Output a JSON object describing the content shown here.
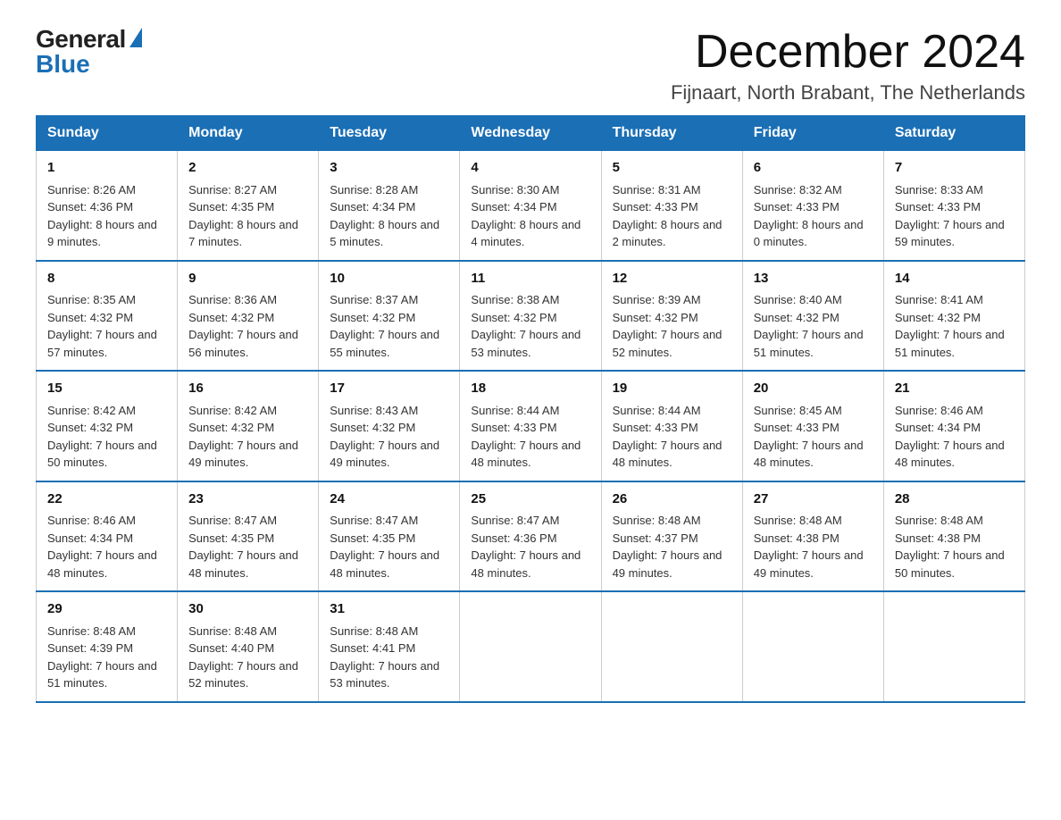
{
  "logo": {
    "general": "General",
    "blue": "Blue"
  },
  "header": {
    "month": "December 2024",
    "location": "Fijnaart, North Brabant, The Netherlands"
  },
  "weekdays": [
    "Sunday",
    "Monday",
    "Tuesday",
    "Wednesday",
    "Thursday",
    "Friday",
    "Saturday"
  ],
  "weeks": [
    [
      {
        "day": "1",
        "sunrise": "8:26 AM",
        "sunset": "4:36 PM",
        "daylight": "8 hours and 9 minutes."
      },
      {
        "day": "2",
        "sunrise": "8:27 AM",
        "sunset": "4:35 PM",
        "daylight": "8 hours and 7 minutes."
      },
      {
        "day": "3",
        "sunrise": "8:28 AM",
        "sunset": "4:34 PM",
        "daylight": "8 hours and 5 minutes."
      },
      {
        "day": "4",
        "sunrise": "8:30 AM",
        "sunset": "4:34 PM",
        "daylight": "8 hours and 4 minutes."
      },
      {
        "day": "5",
        "sunrise": "8:31 AM",
        "sunset": "4:33 PM",
        "daylight": "8 hours and 2 minutes."
      },
      {
        "day": "6",
        "sunrise": "8:32 AM",
        "sunset": "4:33 PM",
        "daylight": "8 hours and 0 minutes."
      },
      {
        "day": "7",
        "sunrise": "8:33 AM",
        "sunset": "4:33 PM",
        "daylight": "7 hours and 59 minutes."
      }
    ],
    [
      {
        "day": "8",
        "sunrise": "8:35 AM",
        "sunset": "4:32 PM",
        "daylight": "7 hours and 57 minutes."
      },
      {
        "day": "9",
        "sunrise": "8:36 AM",
        "sunset": "4:32 PM",
        "daylight": "7 hours and 56 minutes."
      },
      {
        "day": "10",
        "sunrise": "8:37 AM",
        "sunset": "4:32 PM",
        "daylight": "7 hours and 55 minutes."
      },
      {
        "day": "11",
        "sunrise": "8:38 AM",
        "sunset": "4:32 PM",
        "daylight": "7 hours and 53 minutes."
      },
      {
        "day": "12",
        "sunrise": "8:39 AM",
        "sunset": "4:32 PM",
        "daylight": "7 hours and 52 minutes."
      },
      {
        "day": "13",
        "sunrise": "8:40 AM",
        "sunset": "4:32 PM",
        "daylight": "7 hours and 51 minutes."
      },
      {
        "day": "14",
        "sunrise": "8:41 AM",
        "sunset": "4:32 PM",
        "daylight": "7 hours and 51 minutes."
      }
    ],
    [
      {
        "day": "15",
        "sunrise": "8:42 AM",
        "sunset": "4:32 PM",
        "daylight": "7 hours and 50 minutes."
      },
      {
        "day": "16",
        "sunrise": "8:42 AM",
        "sunset": "4:32 PM",
        "daylight": "7 hours and 49 minutes."
      },
      {
        "day": "17",
        "sunrise": "8:43 AM",
        "sunset": "4:32 PM",
        "daylight": "7 hours and 49 minutes."
      },
      {
        "day": "18",
        "sunrise": "8:44 AM",
        "sunset": "4:33 PM",
        "daylight": "7 hours and 48 minutes."
      },
      {
        "day": "19",
        "sunrise": "8:44 AM",
        "sunset": "4:33 PM",
        "daylight": "7 hours and 48 minutes."
      },
      {
        "day": "20",
        "sunrise": "8:45 AM",
        "sunset": "4:33 PM",
        "daylight": "7 hours and 48 minutes."
      },
      {
        "day": "21",
        "sunrise": "8:46 AM",
        "sunset": "4:34 PM",
        "daylight": "7 hours and 48 minutes."
      }
    ],
    [
      {
        "day": "22",
        "sunrise": "8:46 AM",
        "sunset": "4:34 PM",
        "daylight": "7 hours and 48 minutes."
      },
      {
        "day": "23",
        "sunrise": "8:47 AM",
        "sunset": "4:35 PM",
        "daylight": "7 hours and 48 minutes."
      },
      {
        "day": "24",
        "sunrise": "8:47 AM",
        "sunset": "4:35 PM",
        "daylight": "7 hours and 48 minutes."
      },
      {
        "day": "25",
        "sunrise": "8:47 AM",
        "sunset": "4:36 PM",
        "daylight": "7 hours and 48 minutes."
      },
      {
        "day": "26",
        "sunrise": "8:48 AM",
        "sunset": "4:37 PM",
        "daylight": "7 hours and 49 minutes."
      },
      {
        "day": "27",
        "sunrise": "8:48 AM",
        "sunset": "4:38 PM",
        "daylight": "7 hours and 49 minutes."
      },
      {
        "day": "28",
        "sunrise": "8:48 AM",
        "sunset": "4:38 PM",
        "daylight": "7 hours and 50 minutes."
      }
    ],
    [
      {
        "day": "29",
        "sunrise": "8:48 AM",
        "sunset": "4:39 PM",
        "daylight": "7 hours and 51 minutes."
      },
      {
        "day": "30",
        "sunrise": "8:48 AM",
        "sunset": "4:40 PM",
        "daylight": "7 hours and 52 minutes."
      },
      {
        "day": "31",
        "sunrise": "8:48 AM",
        "sunset": "4:41 PM",
        "daylight": "7 hours and 53 minutes."
      },
      null,
      null,
      null,
      null
    ]
  ],
  "labels": {
    "sunrise": "Sunrise:",
    "sunset": "Sunset:",
    "daylight": "Daylight:"
  }
}
